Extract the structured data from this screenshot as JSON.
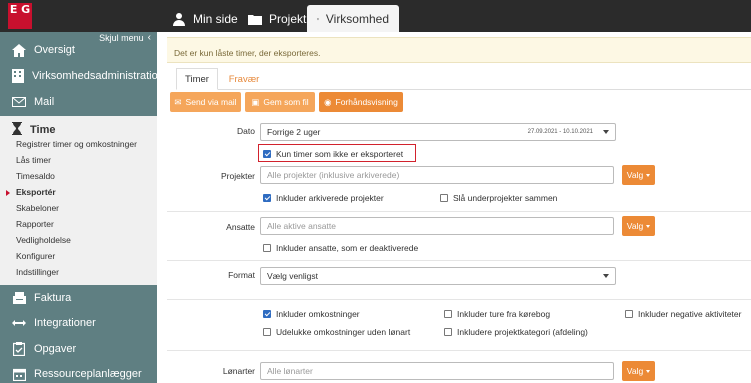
{
  "brand": {
    "logo_text": "E G",
    "brand_color": "#c8102e"
  },
  "topnav": {
    "tabs": [
      {
        "label": "Min side",
        "icon": "person-icon"
      },
      {
        "label": "Projekt",
        "icon": "folder-icon"
      },
      {
        "label": "Virksomhed",
        "icon": "building-icon",
        "active": true
      }
    ]
  },
  "sidebar": {
    "hide_menu": "Skjul menu",
    "items": [
      {
        "label": "Oversigt",
        "icon": "home-icon"
      },
      {
        "label": "Virksomhedsadministration",
        "icon": "building-icon"
      },
      {
        "label": "Mail",
        "icon": "mail-icon"
      }
    ],
    "time": {
      "label": "Time",
      "icon": "hourglass-icon",
      "sub": [
        "Registrer timer og omkostninger",
        "Lås timer",
        "Timesaldo",
        "Eksportér",
        "Skabeloner",
        "Rapporter",
        "Vedligholdelse",
        "Konfigurer",
        "Indstillinger"
      ],
      "active_sub": "Eksportér"
    },
    "items_after": [
      {
        "label": "Faktura",
        "icon": "invoice-icon"
      },
      {
        "label": "Integrationer",
        "icon": "arrows-icon"
      },
      {
        "label": "Opgaver",
        "icon": "clipboard-icon"
      },
      {
        "label": "Ressourceplanlægger",
        "icon": "calendar-icon"
      }
    ]
  },
  "notice": "Det er kun låste timer, der eksporteres.",
  "tabs": {
    "timer": "Timer",
    "fravaer": "Fravær"
  },
  "actions": {
    "send_mail": "Send via mail",
    "save_file": "Gem som fil",
    "preview": "Forhåndsvisning"
  },
  "form": {
    "dato_label": "Dato",
    "dato_value": "Forrige 2 uger",
    "dato_range": "27.09.2021 - 10.10.2021",
    "only_unexported": "Kun timer som ikke er eksporteret",
    "projekter_label": "Projekter",
    "projekter_placeholder": "Alle projekter (inklusive arkiverede)",
    "valg": "Valg",
    "incl_archived": "Inkluder arkiverede projekter",
    "merge_subprojects": "Slå underprojekter sammen",
    "ansatte_label": "Ansatte",
    "ansatte_placeholder": "Alle aktive ansatte",
    "incl_deactivated": "Inkluder ansatte, som er deaktiverede",
    "format_label": "Format",
    "format_value": "Vælg venligst",
    "incl_costs": "Inkluder omkostninger",
    "incl_logbook": "Inkluder ture fra kørebog",
    "incl_negative": "Inkluder negative aktiviteter",
    "exclude_unpaid_costs": "Udelukke omkostninger uden lønart",
    "incl_project_category": "Inkludere projektkategori (afdeling)",
    "loenarter_label": "Lønarter",
    "loenarter_placeholder": "Alle lønarter"
  },
  "checks": {
    "only_unexported": true,
    "incl_archived": true,
    "merge_subprojects": false,
    "incl_deactivated": false,
    "incl_costs": true,
    "incl_logbook": false,
    "incl_negative": false,
    "exclude_unpaid_costs": false,
    "incl_project_category": false
  },
  "colors": {
    "sidebar": "#5f7f82",
    "accent_orange": "#ec8a36",
    "highlight_red": "#d2222d",
    "topbar": "#2b2b2b"
  }
}
